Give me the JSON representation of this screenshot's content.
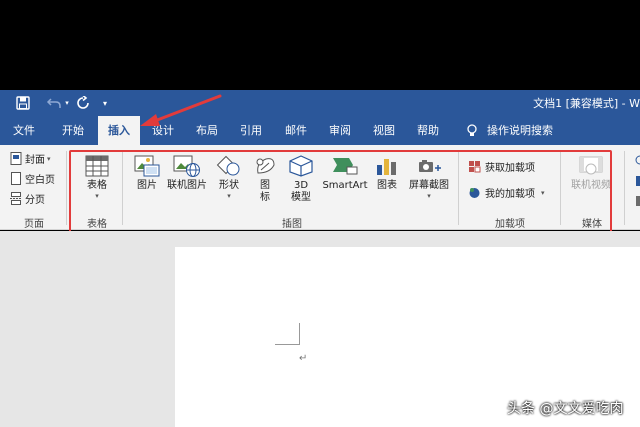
{
  "window": {
    "title": "文档1 [兼容模式] - W"
  },
  "quick_access": {
    "redo_dropdown": "▾",
    "customize": "▾"
  },
  "tabs": [
    "文件",
    "开始",
    "插入",
    "设计",
    "布局",
    "引用",
    "邮件",
    "审阅",
    "视图",
    "帮助"
  ],
  "active_tab": "插入",
  "tell_me": "操作说明搜索",
  "ribbon": {
    "pages_group": {
      "cover": "封面",
      "cover_dropdown": "▾",
      "blank": "空白页",
      "break": "分页",
      "label": "页面"
    },
    "tables_group": {
      "table": "表格",
      "table_dropdown": "▾",
      "label": "表格"
    },
    "illustrations_group": {
      "picture": "图片",
      "online_picture": "联机图片",
      "shapes": "形状",
      "shapes_dropdown": "▾",
      "icons": "图\n标",
      "model3d": "3D\n模型",
      "smartart": "SmartArt",
      "chart": "图表",
      "screenshot": "屏幕截图",
      "screenshot_dropdown": "▾",
      "label": "插图"
    },
    "addins_group": {
      "get_addins": "获取加载项",
      "my_addins": "我的加载项",
      "my_addins_dropdown": "▾",
      "label": "加载项"
    },
    "media_group": {
      "online_video": "联机视频",
      "label": "媒体"
    }
  },
  "document": {
    "para_mark": "↵"
  },
  "watermark": "头条 @文文爱吃肉",
  "colors": {
    "title_bar": "#2b579a",
    "ribbon": "#f3f3f3",
    "highlight": "#e23b3b",
    "annotation_arrow": "#e23b3b"
  }
}
